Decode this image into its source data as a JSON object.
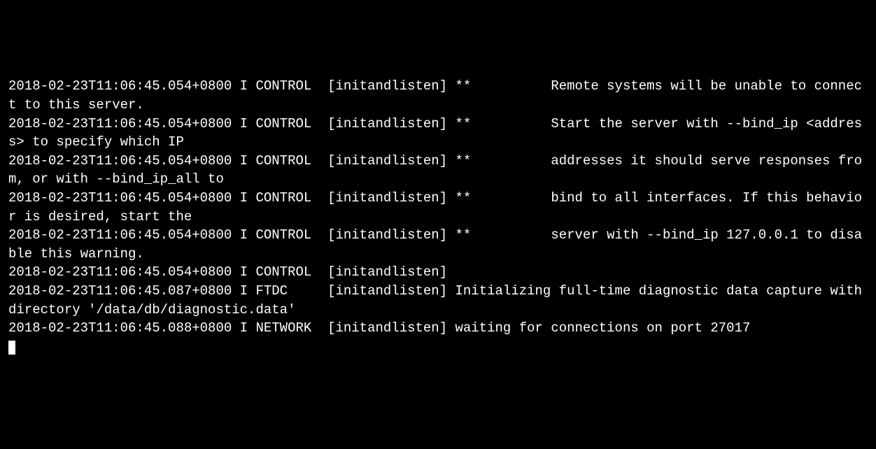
{
  "log": {
    "lines": [
      "2018-02-23T11:06:45.054+0800 I CONTROL  [initandlisten] **          Remote systems will be unable to connect to this server.",
      "2018-02-23T11:06:45.054+0800 I CONTROL  [initandlisten] **          Start the server with --bind_ip <address> to specify which IP",
      "2018-02-23T11:06:45.054+0800 I CONTROL  [initandlisten] **          addresses it should serve responses from, or with --bind_ip_all to",
      "2018-02-23T11:06:45.054+0800 I CONTROL  [initandlisten] **          bind to all interfaces. If this behavior is desired, start the",
      "2018-02-23T11:06:45.054+0800 I CONTROL  [initandlisten] **          server with --bind_ip 127.0.0.1 to disable this warning.",
      "2018-02-23T11:06:45.054+0800 I CONTROL  [initandlisten]",
      "2018-02-23T11:06:45.087+0800 I FTDC     [initandlisten] Initializing full-time diagnostic data capture with directory '/data/db/diagnostic.data'",
      "2018-02-23T11:06:45.088+0800 I NETWORK  [initandlisten] waiting for connections on port 27017"
    ]
  }
}
